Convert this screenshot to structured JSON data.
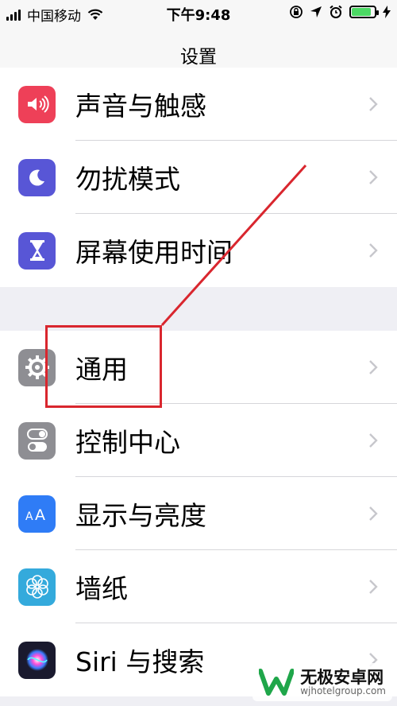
{
  "status_bar": {
    "carrier": "中国移动",
    "time": "下午9:48",
    "battery_level": 0.85,
    "icons": [
      "signal-icon",
      "wifi-icon",
      "rotation-lock-icon",
      "location-icon",
      "alarm-icon",
      "battery-icon",
      "charging-icon"
    ]
  },
  "nav": {
    "title": "设置"
  },
  "group1": {
    "items": [
      {
        "label": "声音与触感",
        "icon": "speaker-icon",
        "color": "#ee4058"
      },
      {
        "label": "勿扰模式",
        "icon": "moon-icon",
        "color": "#5856d6"
      },
      {
        "label": "屏幕使用时间",
        "icon": "hourglass-icon",
        "color": "#5856d6"
      }
    ]
  },
  "group2": {
    "items": [
      {
        "label": "通用",
        "icon": "gear-icon",
        "color": "#8e8e93"
      },
      {
        "label": "控制中心",
        "icon": "toggles-icon",
        "color": "#8e8e93"
      },
      {
        "label": "显示与亮度",
        "icon": "text-size-icon",
        "color": "#2f7cf6"
      },
      {
        "label": "墙纸",
        "icon": "flower-icon",
        "color": "#34aadc"
      },
      {
        "label": "Siri 与搜索",
        "icon": "siri-icon",
        "color": "#1a1a2e"
      }
    ]
  },
  "watermark": {
    "brand": "无极安卓网",
    "site": "wjhotelgroup.com"
  },
  "annotation": {
    "color": "#d9262e",
    "target": "通用"
  }
}
